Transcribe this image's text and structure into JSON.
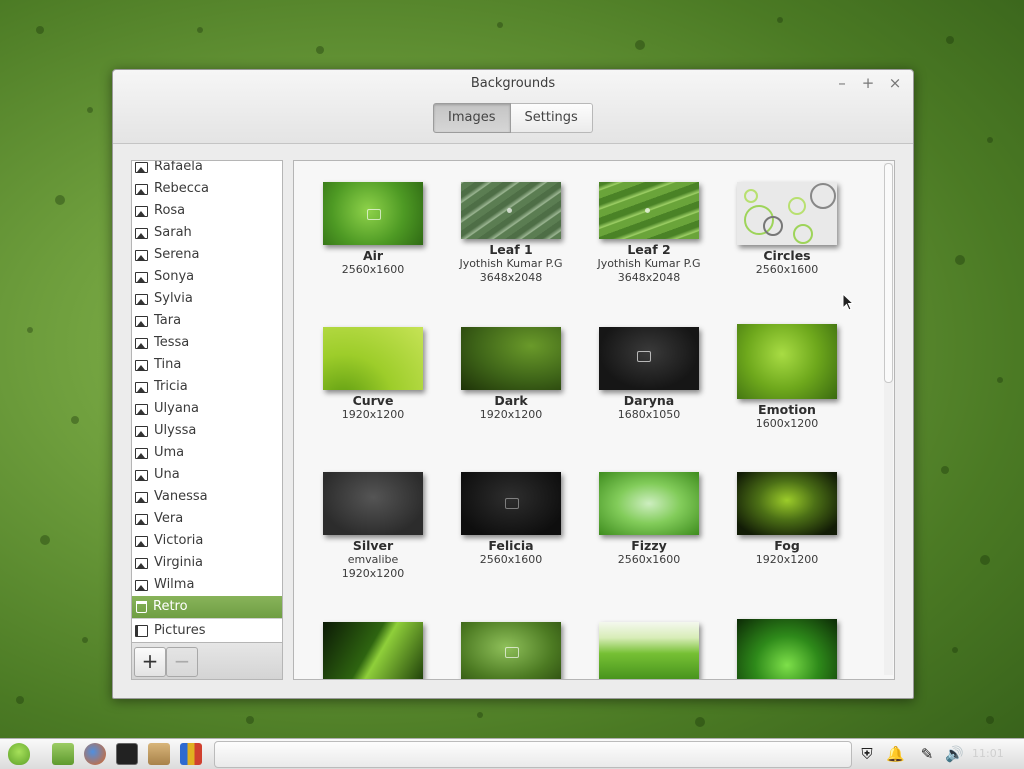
{
  "window": {
    "title": "Backgrounds",
    "tabs": [
      {
        "label": "Images",
        "active": true
      },
      {
        "label": "Settings",
        "active": false
      }
    ]
  },
  "sidebar": {
    "items": [
      "Rafaela",
      "Rebecca",
      "Rosa",
      "Sarah",
      "Serena",
      "Sonya",
      "Sylvia",
      "Tara",
      "Tessa",
      "Tina",
      "Tricia",
      "Ulyana",
      "Ulyssa",
      "Uma",
      "Una",
      "Vanessa",
      "Vera",
      "Victoria",
      "Virginia",
      "Wilma"
    ],
    "selected": "Retro",
    "pictures": "Pictures",
    "add_label": "+",
    "remove_label": "−"
  },
  "wallpapers": [
    {
      "name": "Air",
      "author": "",
      "resolution": "2560x1600"
    },
    {
      "name": "Leaf 1",
      "author": "Jyothish Kumar P.G",
      "resolution": "3648x2048"
    },
    {
      "name": "Leaf 2",
      "author": "Jyothish Kumar P.G",
      "resolution": "3648x2048"
    },
    {
      "name": "Circles",
      "author": "",
      "resolution": "2560x1600"
    },
    {
      "name": "Curve",
      "author": "",
      "resolution": "1920x1200"
    },
    {
      "name": "Dark",
      "author": "",
      "resolution": "1920x1200"
    },
    {
      "name": "Daryna",
      "author": "",
      "resolution": "1680x1050"
    },
    {
      "name": "Emotion",
      "author": "",
      "resolution": "1600x1200"
    },
    {
      "name": "Silver",
      "author": "emvalibe",
      "resolution": "1920x1200"
    },
    {
      "name": "Felicia",
      "author": "",
      "resolution": "2560x1600"
    },
    {
      "name": "Fizzy",
      "author": "",
      "resolution": "2560x1600"
    },
    {
      "name": "Fog",
      "author": "",
      "resolution": "1920x1200"
    }
  ],
  "colors": {
    "accent": "#7aa74d",
    "selection": "#6f9e43"
  },
  "taskbar": {
    "clock": "11:01"
  }
}
